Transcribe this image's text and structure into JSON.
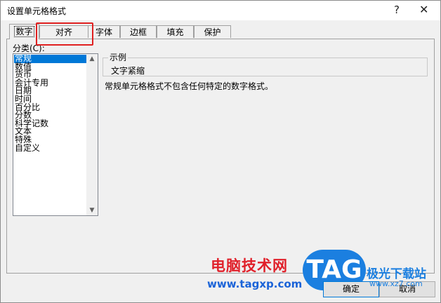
{
  "dialog": {
    "title": "设置单元格格式",
    "help_label": "?",
    "close_label": "✕"
  },
  "tabs": [
    {
      "label": "数字",
      "active": true
    },
    {
      "label": "对齐",
      "active": false
    },
    {
      "label": "字体",
      "active": false
    },
    {
      "label": "边框",
      "active": false
    },
    {
      "label": "填充",
      "active": false
    },
    {
      "label": "保护",
      "active": false
    }
  ],
  "category": {
    "label": "分类(C):",
    "items": [
      "常规",
      "数值",
      "货币",
      "会计专用",
      "日期",
      "时间",
      "百分比",
      "分数",
      "科学记数",
      "文本",
      "特殊",
      "自定义"
    ],
    "selected_index": 0
  },
  "sample": {
    "legend": "示例",
    "value": "文字紧缩"
  },
  "description": "常规单元格格式不包含任何特定的数字格式。",
  "buttons": {
    "ok": "确定",
    "cancel": "取消"
  },
  "watermark": {
    "site_name": "电脑技术网",
    "url": "www.tagxp.com",
    "logo": "TAG",
    "right_text": "极光下载站",
    "right_sub": "www.xz7.com"
  },
  "colors": {
    "selection": "#0078d7",
    "highlight_box": "#e02020",
    "watermark_red": "#e0202a",
    "watermark_blue": "#1b7fe0"
  }
}
